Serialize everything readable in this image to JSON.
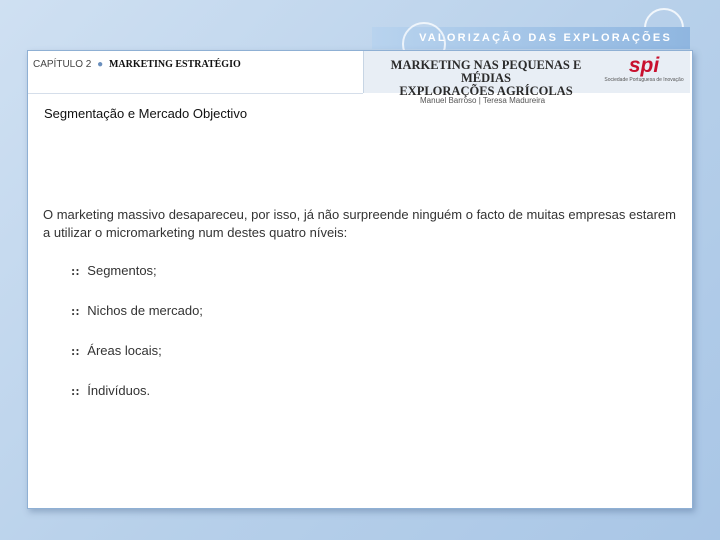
{
  "banner": {
    "text": "VALORIZAÇÃO DAS EXPLORAÇÕES AGRÍCOLAS"
  },
  "header": {
    "chapter": "CAPÍTULO 2",
    "separator": "●",
    "section": "MARKETING ESTRATÉGIO",
    "book_title_line1": "MARKETING NAS PEQUENAS E MÉDIAS",
    "book_title_line2": "EXPLORAÇÕES AGRÍCOLAS",
    "logo_text": "spi",
    "logo_subtitle": "Sociedade Portuguesa de Inovação",
    "authors": "Manuel Barroso | Teresa Madureira"
  },
  "content": {
    "title": "Segmentação e Mercado Objectivo",
    "paragraph": "O marketing massivo desapareceu, por isso, já não surpreende ninguém o facto de muitas empresas estarem a utilizar o micromarketing num destes quatro níveis:",
    "bullet_symbol": "::",
    "items": [
      {
        "label": "Segmentos;"
      },
      {
        "label": "Nichos de mercado;"
      },
      {
        "label": "Áreas locais;"
      },
      {
        "label": "Índivíduos."
      }
    ]
  }
}
